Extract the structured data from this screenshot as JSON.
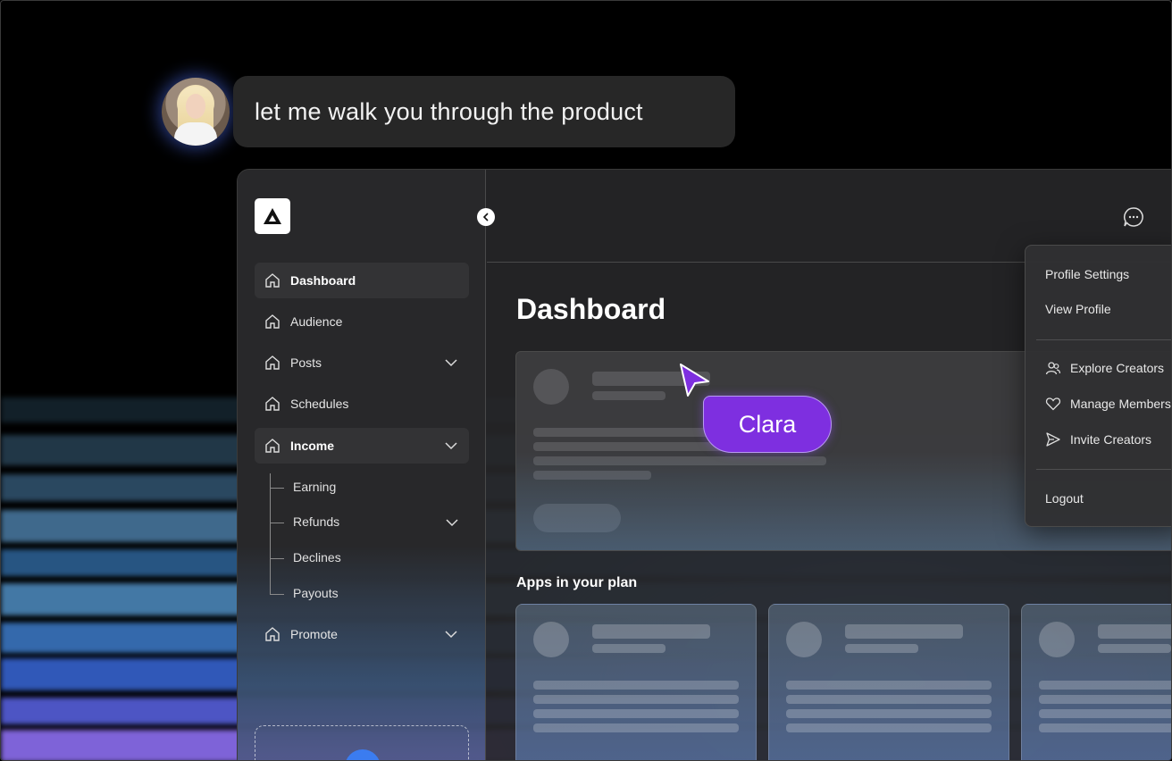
{
  "bubble": {
    "message": "let me walk you through the product"
  },
  "sidebar": {
    "items": [
      {
        "label": "Dashboard"
      },
      {
        "label": "Audience"
      },
      {
        "label": "Posts"
      },
      {
        "label": "Schedules"
      },
      {
        "label": "Income"
      },
      {
        "label": "Promote"
      }
    ],
    "income_sub": [
      {
        "label": "Earning"
      },
      {
        "label": "Refunds"
      },
      {
        "label": "Declines"
      },
      {
        "label": "Payouts"
      }
    ]
  },
  "main": {
    "title": "Dashboard",
    "apps_title": "Apps in your plan"
  },
  "menu": {
    "profile_settings": "Profile Settings",
    "view_profile": "View Profile",
    "explore_creators": "Explore Creators",
    "manage_members": "Manage Members",
    "invite_creators": "Invite Creators",
    "logout": "Logout"
  },
  "cursor": {
    "name": "Clara",
    "color": "#7e2fe0"
  },
  "icons": {
    "logo": "triangle-logo-icon",
    "nav": "home-icon",
    "chat": "chat-bubble-icon",
    "collapse": "chevron-left-icon"
  }
}
